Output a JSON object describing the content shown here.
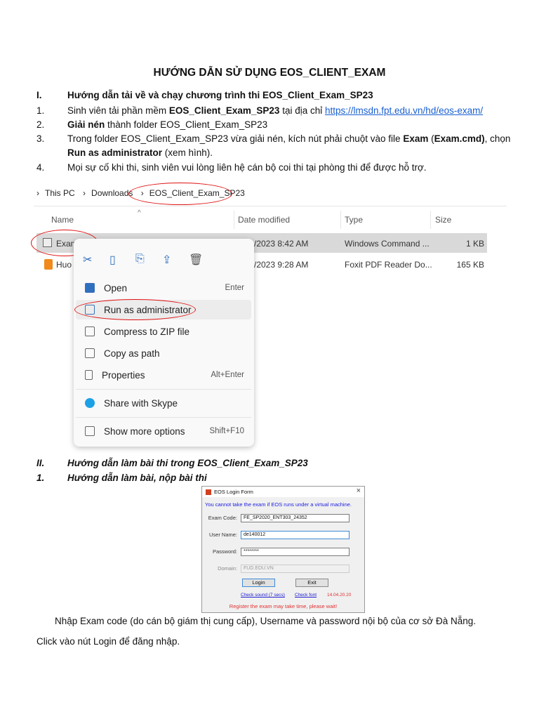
{
  "title": "HƯỚNG DẪN SỬ DỤNG EOS_CLIENT_EXAM",
  "section1": {
    "num": "I.",
    "text": "Hướng dẫn tải về và chạy chương trình thi EOS_Client_Exam_SP23"
  },
  "steps": [
    {
      "num": "1.",
      "pre": "Sinh viên tải phần mềm ",
      "bold": "EOS_Client_Exam_SP23",
      "mid": " tại địa chỉ ",
      "link": "https://lmsdn.fpt.edu.vn/hd/eos-exam/"
    },
    {
      "num": "2.",
      "bold": "Giải nén",
      "rest": " thành folder EOS_Client_Exam_SP23"
    },
    {
      "num": "3.",
      "pre": "Trong folder EOS_Client_Exam_SP23 vừa giải nén, kích nút phải chuột vào file ",
      "bold": "Exam",
      "mid": " (",
      "bold2": "Exam.cmd)",
      "post": ", chọn",
      "bold3": "Run as administrator",
      "rest": " (xem hình)."
    },
    {
      "num": "4.",
      "text": "Mọi sự cố khi thi, sinh viên vui lòng liên hệ cán bộ coi thi tại phòng thi để được hỗ trợ."
    }
  ],
  "explorer": {
    "breadcrumb": [
      "This PC",
      "Downloads",
      "EOS_Client_Exam_SP23"
    ],
    "columns": [
      "Name",
      "Date modified",
      "Type",
      "Size"
    ],
    "files": [
      {
        "name": "Exam",
        "date": "/2023 8:42 AM",
        "type": "Windows Command ...",
        "size": "1 KB"
      },
      {
        "name": "Huo",
        "date": "/2023 9:28 AM",
        "type": "Foxit PDF Reader Do...",
        "size": "165 KB"
      }
    ],
    "menu": [
      {
        "label": "Open",
        "key": "Enter"
      },
      {
        "label": "Run as administrator",
        "key": ""
      },
      {
        "label": "Compress to ZIP file",
        "key": ""
      },
      {
        "label": "Copy as path",
        "key": ""
      },
      {
        "label": "Properties",
        "key": "Alt+Enter"
      },
      {
        "label": "Share with Skype",
        "key": ""
      },
      {
        "label": "Show more options",
        "key": "Shift+F10"
      }
    ]
  },
  "section2": {
    "num": "II.",
    "text": "Hướng dẫn làm bài thi trong EOS_Client_Exam_SP23",
    "sub_num": "1.",
    "sub": "Hướng dẫn làm bài, nộp bài thi"
  },
  "login": {
    "title": "EOS Login Form",
    "close": "×",
    "warning": "You cannot take the exam if EOS runs under a virtual machine.",
    "exam_code_label": "Exam Code:",
    "exam_code": "FE_SP2020_ENT303_24352",
    "user_label": "User Name:",
    "user": "de140012",
    "pass_label": "Password:",
    "pass": "********",
    "domain_label": "Domain:",
    "domain": "FUD.EDU.VN",
    "login_btn": "Login",
    "exit_btn": "Exit",
    "check_sound": "Check sound (7 secs)",
    "check_font": "Check font",
    "version": "14.04.20.20",
    "register": "Register the exam may take time, please wait!"
  },
  "para1": "Nhập Exam code (do cán bộ giám thị cung cấp), Username và password nội bộ của cơ sở Đà Nẵng.",
  "para2": "Click vào nút Login để đăng nhập."
}
